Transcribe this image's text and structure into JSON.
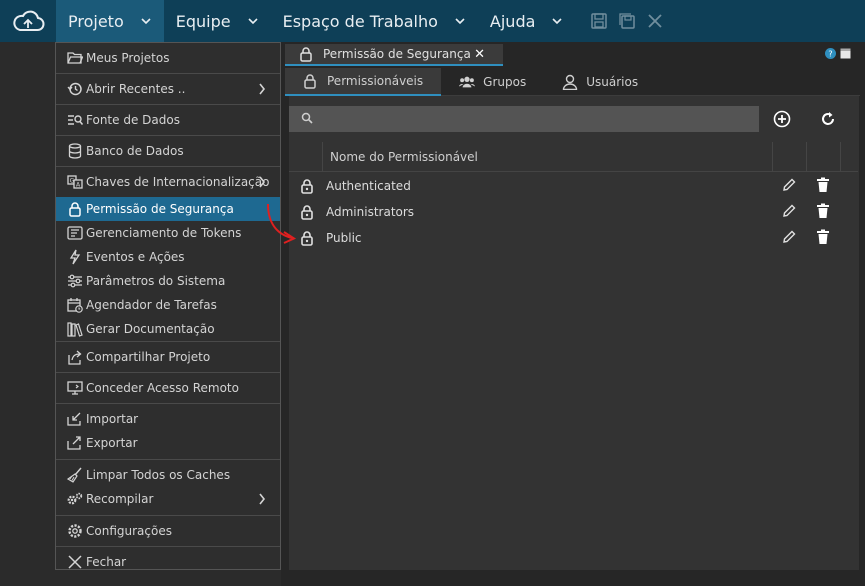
{
  "menubar": {
    "menus": [
      {
        "label": "Projeto",
        "active": true
      },
      {
        "label": "Equipe",
        "active": false
      },
      {
        "label": "Espaço de Trabalho",
        "active": false
      },
      {
        "label": "Ajuda",
        "active": false
      }
    ],
    "toolbar_icons": [
      "save-icon",
      "save-all-icon",
      "close-icon"
    ],
    "accent_color": "#0e3f57"
  },
  "dropdown": {
    "groups": [
      [
        {
          "label": "Meus Projetos",
          "icon": "folder-open-icon",
          "submenu": false
        }
      ],
      [
        {
          "label": "Abrir Recentes ..",
          "icon": "history-icon",
          "submenu": true
        }
      ],
      [
        {
          "label": "Fonte de Dados",
          "icon": "datasource-search-icon",
          "submenu": false
        }
      ],
      [
        {
          "label": "Banco de Dados",
          "icon": "database-icon",
          "submenu": false
        }
      ],
      [
        {
          "label": "Chaves de Internacionalização",
          "icon": "translate-icon",
          "submenu": true
        },
        {
          "label": "Permissão de Segurança",
          "icon": "lock-icon",
          "submenu": false,
          "highlighted": true
        },
        {
          "label": "Gerenciamento de Tokens",
          "icon": "token-icon",
          "submenu": false
        },
        {
          "label": "Eventos e Ações",
          "icon": "bolt-icon",
          "submenu": false
        },
        {
          "label": "Parâmetros do Sistema",
          "icon": "sliders-icon",
          "submenu": false
        },
        {
          "label": "Agendador de Tarefas",
          "icon": "calendar-clock-icon",
          "submenu": false
        },
        {
          "label": "Gerar Documentação",
          "icon": "books-icon",
          "submenu": false
        }
      ],
      [
        {
          "label": "Compartilhar Projeto",
          "icon": "share-icon",
          "submenu": false
        }
      ],
      [
        {
          "label": "Conceder Acesso Remoto",
          "icon": "remote-access-icon",
          "submenu": false
        }
      ],
      [
        {
          "label": "Importar",
          "icon": "import-icon",
          "submenu": false
        },
        {
          "label": "Exportar",
          "icon": "export-icon",
          "submenu": false
        }
      ],
      [
        {
          "label": "Limpar Todos os Caches",
          "icon": "broom-icon",
          "submenu": false
        },
        {
          "label": "Recompilar",
          "icon": "cogs-icon",
          "submenu": true
        }
      ],
      [
        {
          "label": "Configurações",
          "icon": "gear-icon",
          "submenu": false
        }
      ],
      [
        {
          "label": "Fechar",
          "icon": "x-icon",
          "submenu": false
        }
      ]
    ],
    "highlight_color": "#1e6991"
  },
  "document_tab": {
    "label": "Permissão de Segurança",
    "close": "✕"
  },
  "subtabs": [
    {
      "label": "Permissionáveis",
      "icon": "lock-icon",
      "active": true
    },
    {
      "label": "Grupos",
      "icon": "group-icon",
      "active": false
    },
    {
      "label": "Usuários",
      "icon": "user-icon",
      "active": false
    }
  ],
  "search": {
    "value": "",
    "placeholder": ""
  },
  "table": {
    "column_header": "Nome do Permissionável",
    "rows": [
      {
        "name": "Authenticated"
      },
      {
        "name": "Administrators"
      },
      {
        "name": "Public"
      }
    ]
  }
}
